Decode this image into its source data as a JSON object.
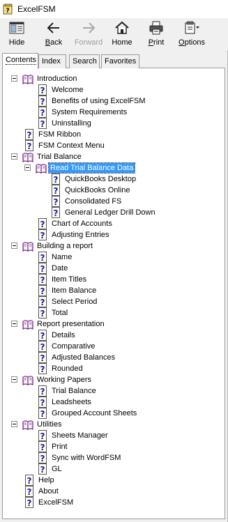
{
  "window": {
    "title": "ExcelFSM"
  },
  "toolbar": {
    "buttons": [
      {
        "label": "Hide",
        "underline": "",
        "rest": "",
        "enabled": true
      },
      {
        "label": "Back",
        "underline": "B",
        "rest": "ack",
        "enabled": true
      },
      {
        "label": "Forward",
        "underline": "",
        "rest": "",
        "enabled": false
      },
      {
        "label": "Home",
        "underline": "",
        "rest": "",
        "enabled": true
      },
      {
        "label": "Print",
        "underline": "P",
        "rest": "rint",
        "enabled": true
      },
      {
        "label": "Options",
        "underline": "O",
        "rest": "ptions",
        "enabled": true
      }
    ]
  },
  "tabs": [
    {
      "label": "Contents",
      "active": true
    },
    {
      "label": "Index",
      "active": false
    },
    {
      "label": "Search",
      "active": false
    },
    {
      "label": "Favorites",
      "active": false
    }
  ],
  "tree": [
    {
      "label": "Introduction",
      "type": "book",
      "level": 0,
      "expanded": true
    },
    {
      "label": "Welcome",
      "type": "page",
      "level": 1
    },
    {
      "label": "Benefits of using ExcelFSM",
      "type": "page",
      "level": 1
    },
    {
      "label": "System Requirements",
      "type": "page",
      "level": 1
    },
    {
      "label": "Uninstalling",
      "type": "page",
      "level": 1
    },
    {
      "label": "FSM Ribbon",
      "type": "page",
      "level": 0
    },
    {
      "label": "FSM Context Menu",
      "type": "page",
      "level": 0
    },
    {
      "label": "Trial Balance",
      "type": "book",
      "level": 0,
      "expanded": true
    },
    {
      "label": "Read Trial Balance Data",
      "type": "book",
      "level": 1,
      "expanded": true,
      "selected": true
    },
    {
      "label": "QuickBooks Desktop",
      "type": "page",
      "level": 2
    },
    {
      "label": "QuickBooks Online",
      "type": "page",
      "level": 2
    },
    {
      "label": "Consolidated FS",
      "type": "page",
      "level": 2
    },
    {
      "label": "General Ledger Drill Down",
      "type": "page",
      "level": 2
    },
    {
      "label": "Chart of Accounts",
      "type": "page",
      "level": 1
    },
    {
      "label": "Adjusting Entries",
      "type": "page",
      "level": 1
    },
    {
      "label": "Building a report",
      "type": "book",
      "level": 0,
      "expanded": true
    },
    {
      "label": "Name",
      "type": "page",
      "level": 1
    },
    {
      "label": "Date",
      "type": "page",
      "level": 1
    },
    {
      "label": "Item Titles",
      "type": "page",
      "level": 1
    },
    {
      "label": "Item Balance",
      "type": "page",
      "level": 1
    },
    {
      "label": "Select Period",
      "type": "page",
      "level": 1
    },
    {
      "label": "Total",
      "type": "page",
      "level": 1
    },
    {
      "label": "Report presentation",
      "type": "book",
      "level": 0,
      "expanded": true
    },
    {
      "label": "Details",
      "type": "page",
      "level": 1
    },
    {
      "label": "Comparative",
      "type": "page",
      "level": 1
    },
    {
      "label": "Adjusted Balances",
      "type": "page",
      "level": 1
    },
    {
      "label": "Rounded",
      "type": "page",
      "level": 1
    },
    {
      "label": "Working Papers",
      "type": "book",
      "level": 0,
      "expanded": true
    },
    {
      "label": "Trial Balance",
      "type": "page",
      "level": 1
    },
    {
      "label": "Leadsheets",
      "type": "page",
      "level": 1
    },
    {
      "label": "Grouped Account Sheets",
      "type": "page",
      "level": 1
    },
    {
      "label": "Utilities",
      "type": "book",
      "level": 0,
      "expanded": true
    },
    {
      "label": "Sheets Manager",
      "type": "page",
      "level": 1
    },
    {
      "label": "Print",
      "type": "page",
      "level": 1
    },
    {
      "label": "Sync with WordFSM",
      "type": "page",
      "level": 1
    },
    {
      "label": "GL",
      "type": "page",
      "level": 1
    },
    {
      "label": "Help",
      "type": "page",
      "level": 0
    },
    {
      "label": "About",
      "type": "page",
      "level": 0
    },
    {
      "label": "ExcelFSM",
      "type": "page",
      "level": 0
    }
  ],
  "colors": {
    "selection": "#3399ff",
    "book": "#7a2a8a",
    "page": "#1a1a9a"
  }
}
